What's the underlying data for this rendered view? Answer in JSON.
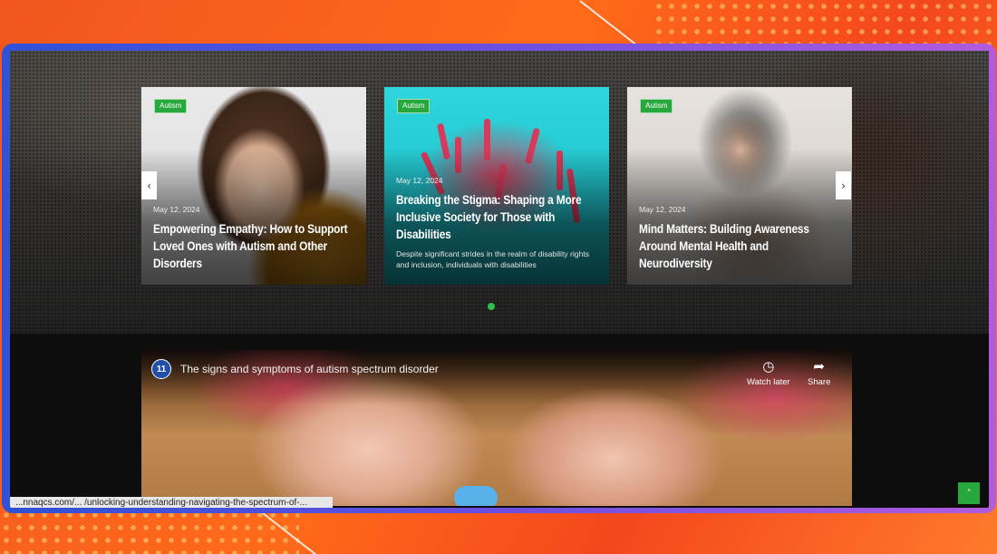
{
  "carousel": {
    "prev_icon": "‹",
    "next_icon": "›",
    "cards": [
      {
        "tag": "Autism",
        "date": "May 12, 2024",
        "title": "Empowering Empathy: How to Support Loved Ones with Autism and Other Disorders",
        "excerpt": ""
      },
      {
        "tag": "Autism",
        "date": "May 12, 2024",
        "title": "Breaking the Stigma: Shaping a More Inclusive Society for Those with Disabilities",
        "excerpt": "Despite significant strides in the realm of disability rights and inclusion, individuals with disabilities"
      },
      {
        "tag": "Autism",
        "date": "May 12, 2024",
        "title": "Mind Matters: Building Awareness Around Mental Health and Neurodiversity",
        "excerpt": ""
      }
    ],
    "active_dot": 1
  },
  "video": {
    "channel_badge": "11",
    "title": "The signs and symptoms of autism spectrum disorder",
    "watch_later_label": "Watch later",
    "share_label": "Share",
    "watch_later_icon": "clock-icon",
    "share_icon": "share-arrow-icon"
  },
  "status_bar": {
    "url": "...nnaqcs.com/... /unlocking-understanding-navigating-the-spectrum-of-..."
  },
  "back_to_top": {
    "icon": "chevron-up-icon",
    "glyph": "˄"
  },
  "colors": {
    "accent_green": "#27a83c",
    "frame_blue": "#2d52d8",
    "frame_purple": "#b25bdd",
    "background_orange": "#ff6a1a"
  }
}
